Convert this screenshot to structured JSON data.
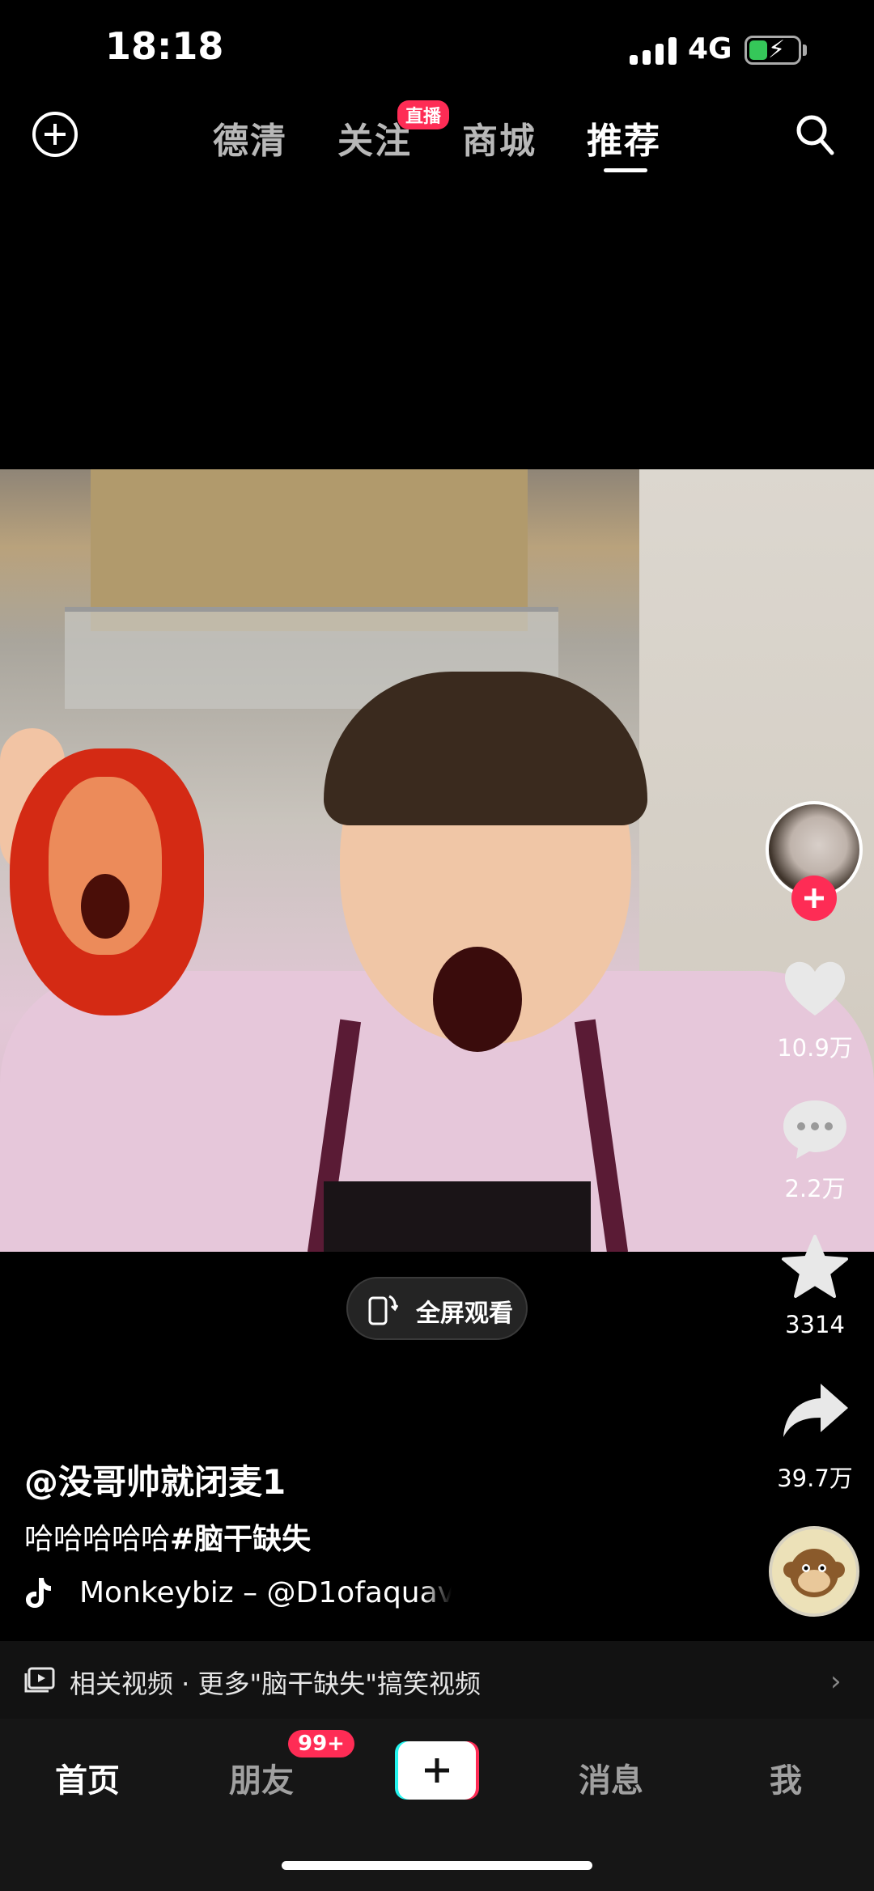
{
  "status_bar": {
    "time": "18:18",
    "network": "4G"
  },
  "top_nav": {
    "tabs": [
      {
        "label": "德清"
      },
      {
        "label": "关注",
        "badge": "直播"
      },
      {
        "label": "商城"
      },
      {
        "label": "推荐",
        "active": true
      }
    ]
  },
  "video": {
    "fullscreen_label": "全屏观看"
  },
  "actions": {
    "likes": "10.9万",
    "comments": "2.2万",
    "favorites": "3314",
    "shares": "39.7万"
  },
  "caption": {
    "author": "@没哥帅就闭麦1",
    "text": "哈哈哈哈哈",
    "hashtag": "#脑干缺失",
    "music": "Monkeybiz – @D1ofaquavi"
  },
  "related": {
    "text": "相关视频 · 更多\"脑干缺失\"搞笑视频"
  },
  "bottom_nav": {
    "items": [
      "首页",
      "朋友",
      "消息",
      "我"
    ],
    "friends_badge": "99+"
  },
  "colors": {
    "accent": "#fe2c55",
    "battery": "#35c759"
  }
}
